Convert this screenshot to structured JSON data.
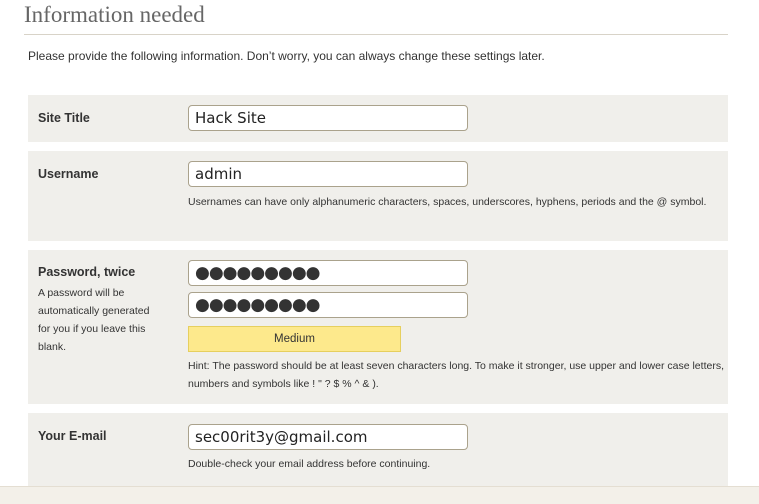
{
  "page": {
    "title": "Information needed",
    "intro": "Please provide the following information. Don’t worry, you can always change these settings later."
  },
  "site_title": {
    "label": "Site Title",
    "value": "Hack Site"
  },
  "username": {
    "label": "Username",
    "value": "admin",
    "help": "Usernames can have only alphanumeric characters, spaces, underscores, hyphens, periods and the @ symbol."
  },
  "password": {
    "label": "Password, twice",
    "description": "A password will be automatically generated for you if you leave this blank.",
    "value_masked_1": "●●●●●●●●●",
    "value_masked_2": "●●●●●●●●●",
    "strength": "Medium",
    "strength_color": "#fde98c",
    "hint": "Hint: The password should be at least seven characters long. To make it stronger, use upper and lower case letters, numbers and symbols like ! \" ? $ % ^ & )."
  },
  "email": {
    "label": "Your E-mail",
    "value": "sec00rit3y@gmail.com",
    "help": "Double-check your email address before continuing."
  }
}
